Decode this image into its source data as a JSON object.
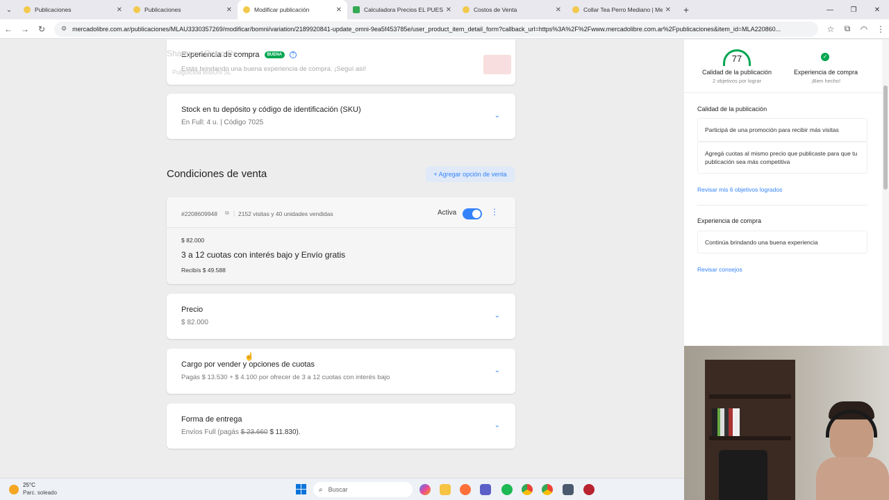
{
  "browser": {
    "tabs": [
      {
        "title": "Publicaciones",
        "color": "#f2c94c"
      },
      {
        "title": "Publicaciones",
        "color": "#f2c94c"
      },
      {
        "title": "Modificar publicación",
        "color": "#f2c94c"
      },
      {
        "title": "Calculadora Precios EL PUESTO",
        "color": "#34a853"
      },
      {
        "title": "Costos de Venta",
        "color": "#f2c94c"
      },
      {
        "title": "Collar Tea Perro Mediano | Mer",
        "color": "#f2c94c"
      }
    ],
    "url": "mercadolibre.com.ar/publicaciones/MLAU3330357269/modificar/bomni/variation/2189920841-update_omni-9ea5f453785e/user_product_item_detail_form?callback_url=https%3A%2F%2Fwww.mercadolibre.com.ar%2Fpublicaciones&item_id=MLA220860..."
  },
  "main": {
    "experience": {
      "title": "Experiencia de compra",
      "badge": "BUENA",
      "subtitle": "Estás brindando una buena experiencia de compra. ¡Seguí así!"
    },
    "ghost_text": {
      "line1": "Shampoo Perro Pr...",
      "line2": "Pulguicida BIBUN SL"
    },
    "stock": {
      "title": "Stock en tu depósito y código de identificación (SKU)",
      "subtitle": "En Full: 4 u. | Código 7025"
    },
    "conditions": {
      "heading": "Condiciones de venta",
      "add_button": "+ Agregar opción de venta",
      "id": "#2208609948",
      "stats": "2152 visitas y 40 unidades vendidas",
      "status": "Activa",
      "price_small": "$ 82.000",
      "headline": "3 a 12 cuotas con interés bajo y Envío gratis",
      "receive": "Recibís $ 49.588"
    },
    "price": {
      "title": "Precio",
      "value": "$ 82.000"
    },
    "fee": {
      "title": "Cargo por vender y opciones de cuotas",
      "subtitle": "Pagás $ 13.530 + $ 4.100 por ofrecer de 3 a 12 cuotas con interés bajo"
    },
    "delivery": {
      "title": "Forma de entrega",
      "prefix": "Envíos Full (pagás ",
      "old": "$ 23.660",
      "new": " $ 11.830)."
    }
  },
  "side": {
    "quality_score": "77",
    "quality_label": "Calidad de la publicación",
    "quality_sub": "2 objetivos por lograr",
    "experience_label": "Experiencia de compra",
    "experience_sub": "¡Bien hecho!",
    "quality_section": "Calidad de la publicación",
    "tips": [
      "Participá de una promoción para recibir más visitas",
      "Agregá cuotas al mismo precio que publicaste para que tu publicación sea más competitiva"
    ],
    "review_link": "Revisar mis 6 objetivos logrados",
    "experience_section": "Experiencia de compra",
    "experience_tip": "Continúa brindando una buena experiencia",
    "advice_link": "Revisar consejos"
  },
  "taskbar": {
    "temp": "25°C",
    "weather": "Parc. soleado",
    "search_placeholder": "Buscar"
  }
}
